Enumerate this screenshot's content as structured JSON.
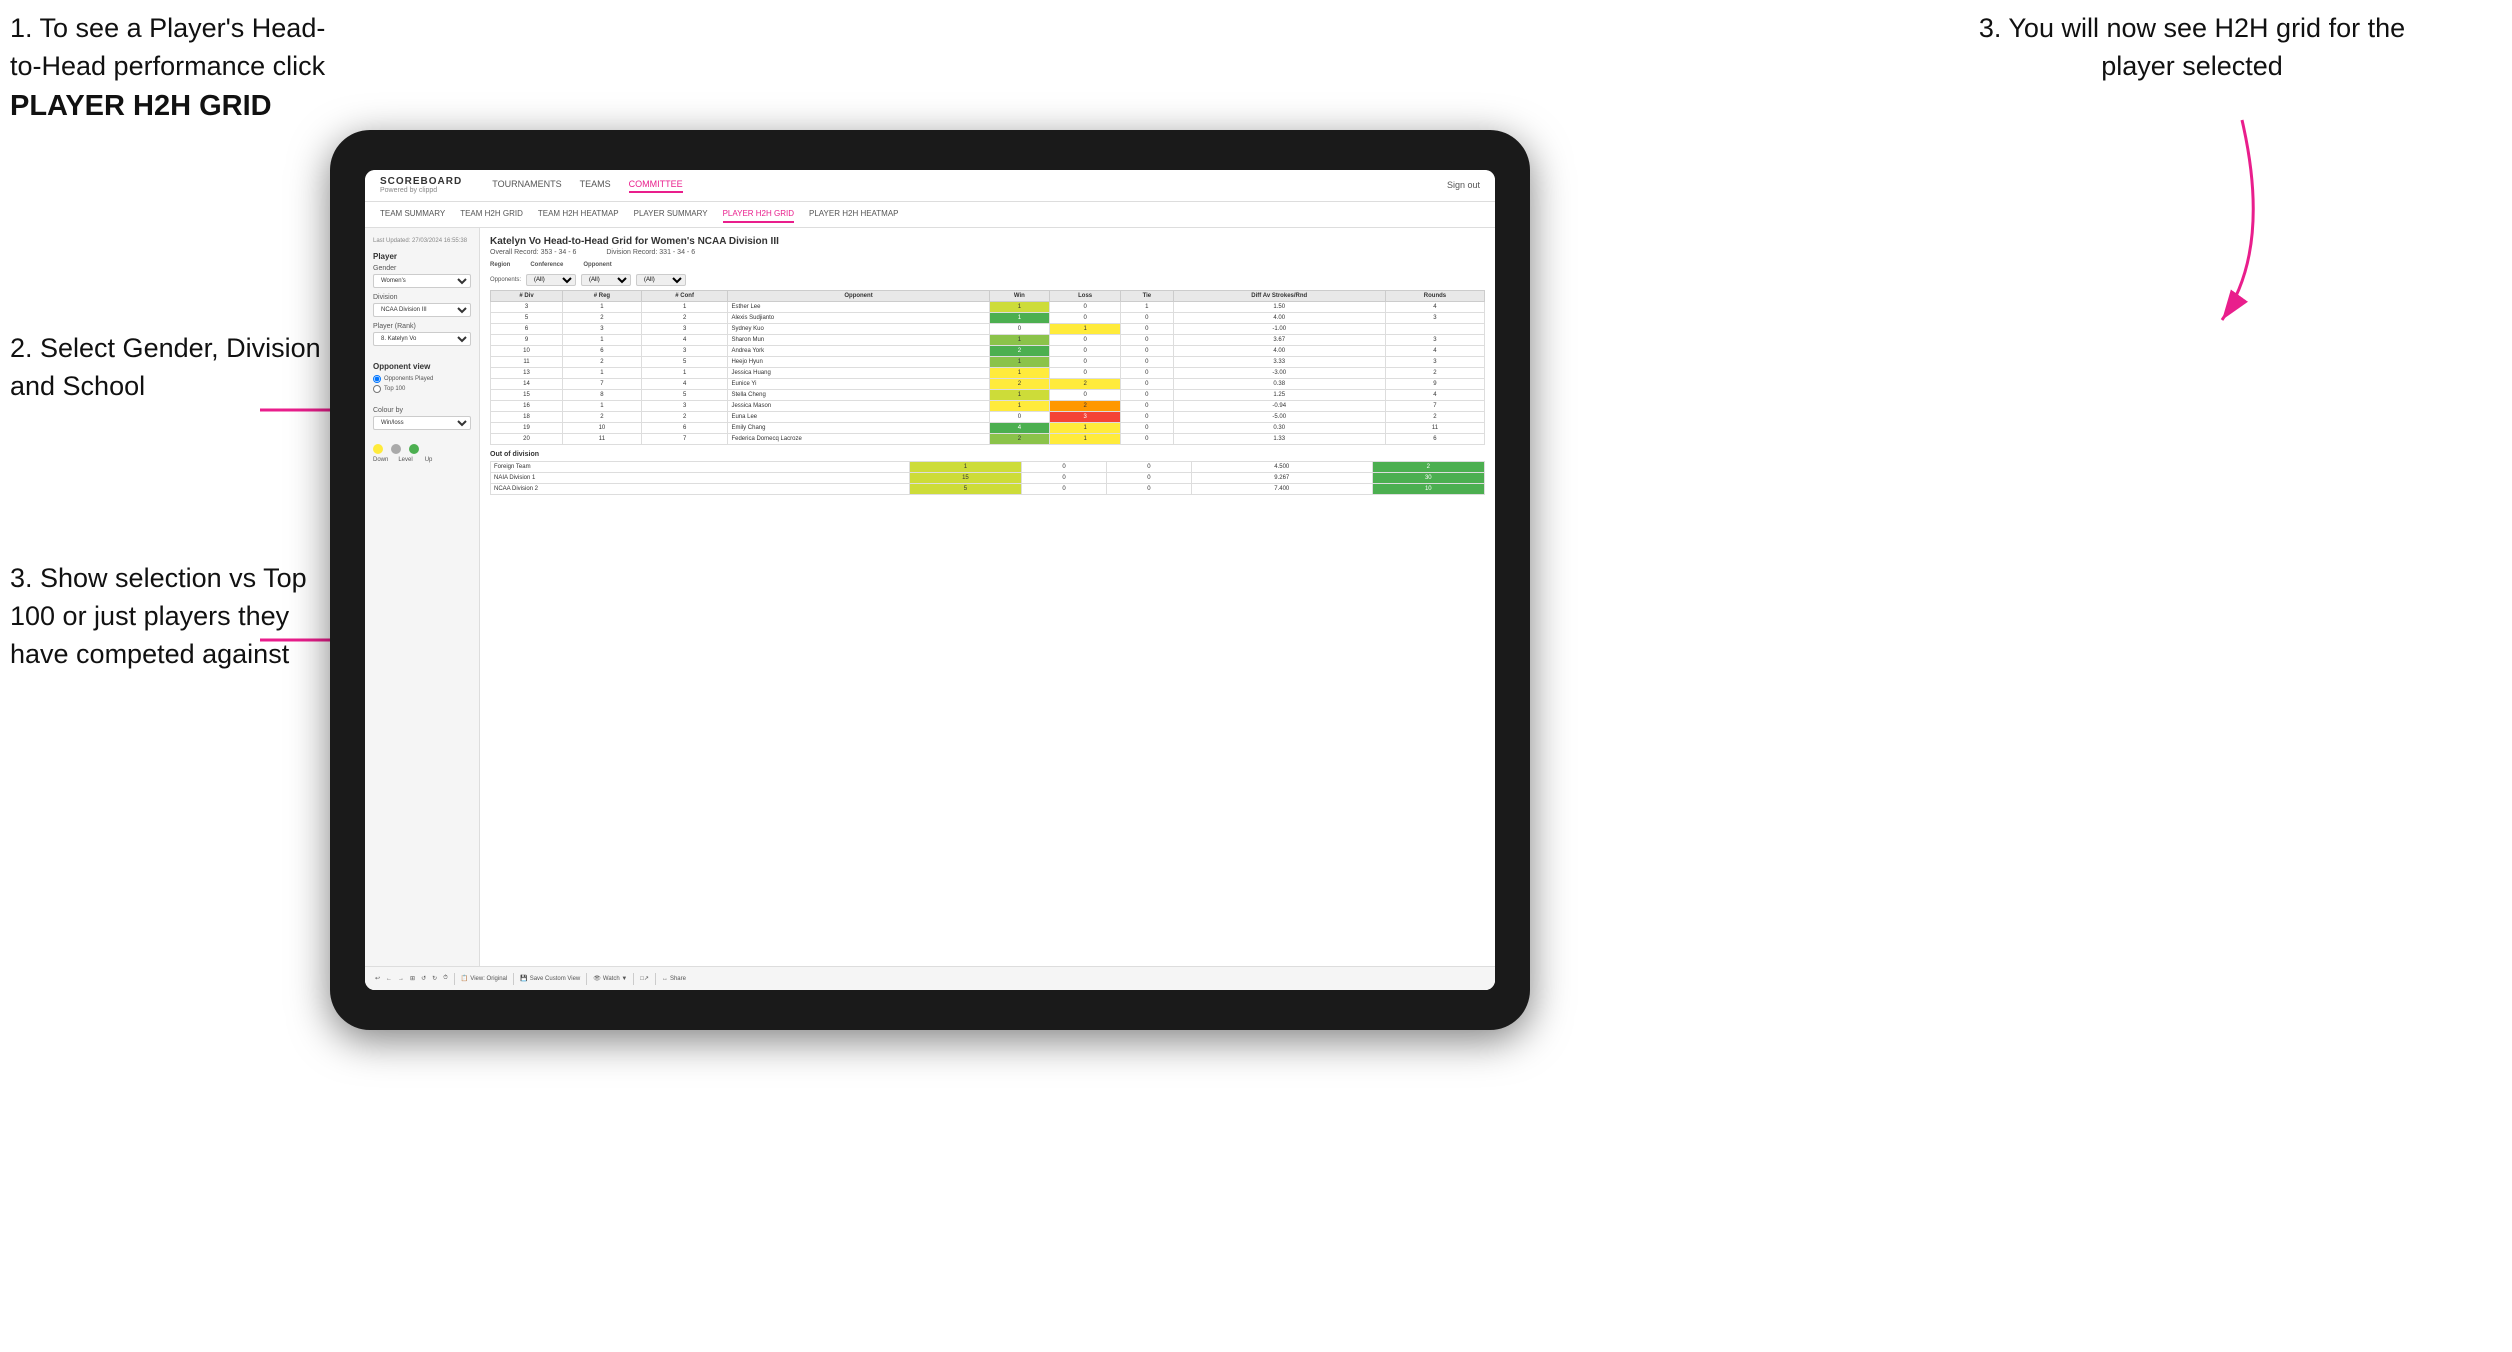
{
  "instructions": {
    "top_left_1": "1. To see a Player's Head-to-Head performance click",
    "top_left_1_bold": "PLAYER H2H GRID",
    "top_right": "3. You will now see H2H grid for the player selected",
    "left_2": "2. Select Gender, Division and School",
    "left_3": "3. Show selection vs Top 100 or just players they have competed against"
  },
  "header": {
    "logo": "SCOREBOARD",
    "logo_sub": "Powered by clippd",
    "nav": [
      "TOURNAMENTS",
      "TEAMS",
      "COMMITTEE"
    ],
    "sign_out": "Sign out"
  },
  "sub_nav": {
    "items": [
      "TEAM SUMMARY",
      "TEAM H2H GRID",
      "TEAM H2H HEATMAP",
      "PLAYER SUMMARY",
      "PLAYER H2H GRID",
      "PLAYER H2H HEATMAP"
    ]
  },
  "sidebar": {
    "timestamp": "Last Updated: 27/03/2024 16:55:38",
    "player_section": "Player",
    "gender_label": "Gender",
    "gender_value": "Women's",
    "division_label": "Division",
    "division_value": "NCAA Division III",
    "player_rank_label": "Player (Rank)",
    "player_rank_value": "8. Katelyn Vo",
    "opponent_view_label": "Opponent view",
    "radio_opponents": "Opponents Played",
    "radio_top100": "Top 100",
    "colour_by_label": "Colour by",
    "colour_by_value": "Win/loss",
    "legend": {
      "down": "Down",
      "level": "Level",
      "up": "Up"
    }
  },
  "main": {
    "title": "Katelyn Vo Head-to-Head Grid for Women's NCAA Division III",
    "overall_record": "Overall Record: 353 - 34 - 6",
    "division_record": "Division Record: 331 - 34 - 6",
    "region_label": "Region",
    "conference_label": "Conference",
    "opponent_label": "Opponent",
    "opponents_label": "Opponents:",
    "opponents_value": "(All)",
    "conference_value": "(All)",
    "opponent_value": "(All)",
    "columns": [
      "# Div",
      "# Reg",
      "# Conf",
      "Opponent",
      "Win",
      "Loss",
      "Tie",
      "Diff Av Strokes/Rnd",
      "Rounds"
    ],
    "rows": [
      {
        "div": "3",
        "reg": "1",
        "conf": "1",
        "opponent": "Esther Lee",
        "win": 1,
        "loss": 0,
        "tie": 1,
        "diff": "1.50",
        "rounds": 4,
        "win_color": "green-light",
        "loss_color": "neutral",
        "tie_color": "neutral"
      },
      {
        "div": "5",
        "reg": "2",
        "conf": "2",
        "opponent": "Alexis Sudjianto",
        "win": 1,
        "loss": 0,
        "tie": 0,
        "diff": "4.00",
        "rounds": 3,
        "win_color": "green-dark",
        "loss_color": "neutral",
        "tie_color": "neutral"
      },
      {
        "div": "6",
        "reg": "3",
        "conf": "3",
        "opponent": "Sydney Kuo",
        "win": 0,
        "loss": 1,
        "tie": 0,
        "diff": "-1.00",
        "rounds": "",
        "win_color": "neutral",
        "loss_color": "yellow",
        "tie_color": "neutral"
      },
      {
        "div": "9",
        "reg": "1",
        "conf": "4",
        "opponent": "Sharon Mun",
        "win": 1,
        "loss": 0,
        "tie": 0,
        "diff": "3.67",
        "rounds": 3,
        "win_color": "green-mid",
        "loss_color": "neutral",
        "tie_color": "neutral"
      },
      {
        "div": "10",
        "reg": "6",
        "conf": "3",
        "opponent": "Andrea York",
        "win": 2,
        "loss": 0,
        "tie": 0,
        "diff": "4.00",
        "rounds": 4,
        "win_color": "green-dark",
        "loss_color": "neutral",
        "tie_color": "neutral"
      },
      {
        "div": "11",
        "reg": "2",
        "conf": "5",
        "opponent": "Heejo Hyun",
        "win": 1,
        "loss": 0,
        "tie": 0,
        "diff": "3.33",
        "rounds": 3,
        "win_color": "green-mid",
        "loss_color": "neutral",
        "tie_color": "neutral"
      },
      {
        "div": "13",
        "reg": "1",
        "conf": "1",
        "opponent": "Jessica Huang",
        "win": 1,
        "loss": 0,
        "tie": 0,
        "diff": "-3.00",
        "rounds": 2,
        "win_color": "yellow",
        "loss_color": "neutral",
        "tie_color": "neutral"
      },
      {
        "div": "14",
        "reg": "7",
        "conf": "4",
        "opponent": "Eunice Yi",
        "win": 2,
        "loss": 2,
        "tie": 0,
        "diff": "0.38",
        "rounds": 9,
        "win_color": "yellow",
        "loss_color": "yellow",
        "tie_color": "neutral"
      },
      {
        "div": "15",
        "reg": "8",
        "conf": "5",
        "opponent": "Stella Cheng",
        "win": 1,
        "loss": 0,
        "tie": 0,
        "diff": "1.25",
        "rounds": 4,
        "win_color": "green-light",
        "loss_color": "neutral",
        "tie_color": "neutral"
      },
      {
        "div": "16",
        "reg": "1",
        "conf": "3",
        "opponent": "Jessica Mason",
        "win": 1,
        "loss": 2,
        "tie": 0,
        "diff": "-0.94",
        "rounds": 7,
        "win_color": "yellow",
        "loss_color": "orange",
        "tie_color": "neutral"
      },
      {
        "div": "18",
        "reg": "2",
        "conf": "2",
        "opponent": "Euna Lee",
        "win": 0,
        "loss": 3,
        "tie": 0,
        "diff": "-5.00",
        "rounds": 2,
        "win_color": "neutral",
        "loss_color": "red",
        "tie_color": "neutral"
      },
      {
        "div": "19",
        "reg": "10",
        "conf": "6",
        "opponent": "Emily Chang",
        "win": 4,
        "loss": 1,
        "tie": 0,
        "diff": "0.30",
        "rounds": 11,
        "win_color": "green-dark",
        "loss_color": "yellow",
        "tie_color": "neutral"
      },
      {
        "div": "20",
        "reg": "11",
        "conf": "7",
        "opponent": "Federica Domecq Lacroze",
        "win": 2,
        "loss": 1,
        "tie": 0,
        "diff": "1.33",
        "rounds": 6,
        "win_color": "green-mid",
        "loss_color": "yellow",
        "tie_color": "neutral"
      }
    ],
    "out_of_division_title": "Out of division",
    "out_of_division_rows": [
      {
        "label": "Foreign Team",
        "win": 1,
        "loss": 0,
        "tie": 0,
        "diff": "4.500",
        "rounds": 2
      },
      {
        "label": "NAIA Division 1",
        "win": 15,
        "loss": 0,
        "tie": 0,
        "diff": "9.267",
        "rounds": 30
      },
      {
        "label": "NCAA Division 2",
        "win": 5,
        "loss": 0,
        "tie": 0,
        "diff": "7.400",
        "rounds": 10
      }
    ]
  },
  "toolbar": {
    "buttons": [
      "↩",
      "←",
      "→",
      "⊞",
      "↺",
      "↻",
      "⏱",
      "View: Original",
      "Save Custom View",
      "Watch ▼",
      "□↗",
      "↔",
      "Share"
    ]
  },
  "colors": {
    "accent": "#e91e8c",
    "green_dark": "#4caf50",
    "green_mid": "#8bc34a",
    "yellow": "#ffeb3b",
    "orange": "#ff9800",
    "red": "#f44336"
  }
}
